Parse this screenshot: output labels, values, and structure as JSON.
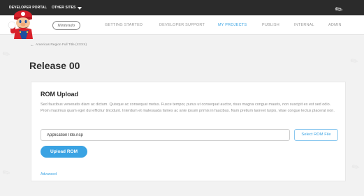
{
  "topbar": {
    "portal_label": "DEVELOPER PORTAL",
    "sites_label": "OTHER SITES"
  },
  "navbar": {
    "logo_text": "Nintendo",
    "items": [
      {
        "label": "GETTING STARTED",
        "active": false
      },
      {
        "label": "DEVELOPER SUPPORT",
        "active": false
      },
      {
        "label": "MY PROJECTS",
        "active": true
      },
      {
        "label": "PUBLISH",
        "active": false
      },
      {
        "label": "INTERNAL",
        "active": false
      },
      {
        "label": "ADMIN",
        "active": false
      }
    ]
  },
  "breadcrumb": {
    "text": "Americas Region Full Title (XXXX)"
  },
  "page": {
    "title": "Release 00"
  },
  "rom_upload": {
    "title": "ROM Upload",
    "description": "Sed faucibus venenatis diam ac dictum. Quisque ac consequat metus. Fusce tempor, purus ut consequat auctor, risus magna congue mauris, non suscipit ex est sed odio. Proin maximus quam eget dui efficitur tincidunt. Interdum et malesuada fames ac ante ipsum primis in faucibus. Nam pretium laoreet turpis, vitae congue lectus placerat non.",
    "file_value": "ApplicationTitle.nsp",
    "select_button_label": "Select ROM File",
    "upload_button_label": "Upload ROM",
    "advanced_label": "Advanced"
  },
  "colors": {
    "accent": "#3aa3e3",
    "topbar": "#2b2b2b",
    "background": "#f2f2f2"
  }
}
